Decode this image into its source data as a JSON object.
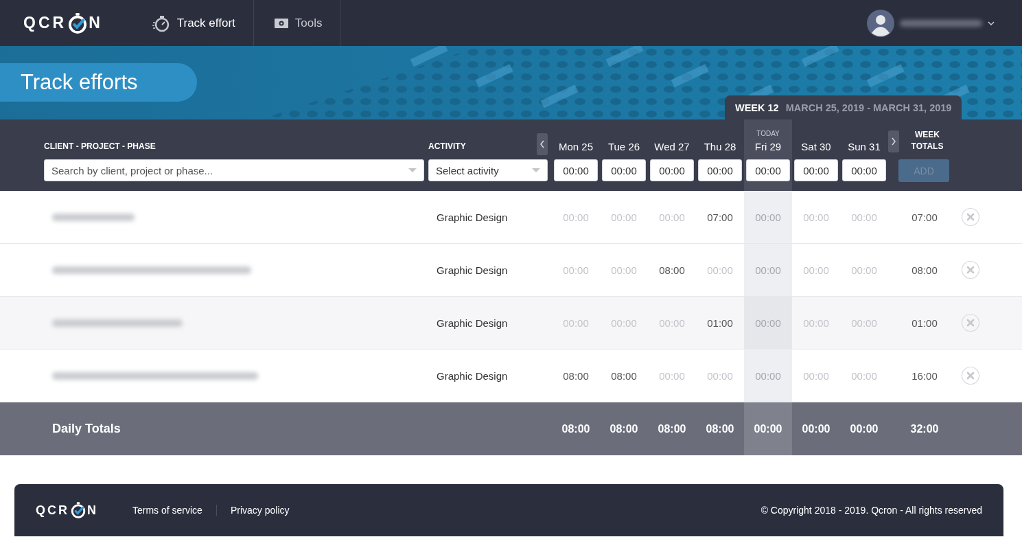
{
  "nav": {
    "logo": {
      "left": "QCR",
      "right": "N"
    },
    "items": [
      {
        "label": "Track effort",
        "selected": true
      },
      {
        "label": "Tools",
        "selected": false
      }
    ]
  },
  "banner": {
    "title": "Track efforts",
    "week": {
      "number": "WEEK 12",
      "range": "MARCH 25, 2019 - MARCH 31, 2019"
    }
  },
  "entry": {
    "project_label": "CLIENT - PROJECT - PHASE",
    "project_search": {
      "placeholder": "Search by client, project or phase..."
    },
    "activity_label": "ACTIVITY",
    "activity_select": {
      "value": "Select activity"
    },
    "days": [
      {
        "label": "Mon 25",
        "today": false,
        "input": "00:00"
      },
      {
        "label": "Tue 26",
        "today": false,
        "input": "00:00"
      },
      {
        "label": "Wed 27",
        "today": false,
        "input": "00:00"
      },
      {
        "label": "Thu 28",
        "today": false,
        "input": "00:00"
      },
      {
        "label": "Fri 29",
        "today": true,
        "note": "TODAY",
        "input": "00:00"
      },
      {
        "label": "Sat 30",
        "today": false,
        "input": "00:00"
      },
      {
        "label": "Sun 31",
        "today": false,
        "input": "00:00"
      }
    ],
    "totals_label": "WEEK TOTALS",
    "add_button": {
      "label": "ADD",
      "disabled": true
    }
  },
  "rows": [
    {
      "activity": "Graphic Design",
      "highlighted": false,
      "cells": [
        {
          "value": "00:00",
          "filled": false
        },
        {
          "value": "00:00",
          "filled": false
        },
        {
          "value": "00:00",
          "filled": false
        },
        {
          "value": "07:00",
          "filled": true
        },
        {
          "value": "00:00",
          "filled": false
        },
        {
          "value": "00:00",
          "filled": false
        },
        {
          "value": "00:00",
          "filled": false
        }
      ],
      "total": "07:00"
    },
    {
      "activity": "Graphic Design",
      "highlighted": false,
      "cells": [
        {
          "value": "00:00",
          "filled": false
        },
        {
          "value": "00:00",
          "filled": false
        },
        {
          "value": "08:00",
          "filled": true
        },
        {
          "value": "00:00",
          "filled": false
        },
        {
          "value": "00:00",
          "filled": false
        },
        {
          "value": "00:00",
          "filled": false
        },
        {
          "value": "00:00",
          "filled": false
        }
      ],
      "total": "08:00"
    },
    {
      "activity": "Graphic Design",
      "highlighted": true,
      "cells": [
        {
          "value": "00:00",
          "filled": false
        },
        {
          "value": "00:00",
          "filled": false
        },
        {
          "value": "00:00",
          "filled": false
        },
        {
          "value": "01:00",
          "filled": true
        },
        {
          "value": "00:00",
          "filled": false
        },
        {
          "value": "00:00",
          "filled": false
        },
        {
          "value": "00:00",
          "filled": false
        }
      ],
      "total": "01:00"
    },
    {
      "activity": "Graphic Design",
      "highlighted": false,
      "cells": [
        {
          "value": "08:00",
          "filled": true
        },
        {
          "value": "08:00",
          "filled": true
        },
        {
          "value": "00:00",
          "filled": false
        },
        {
          "value": "00:00",
          "filled": false
        },
        {
          "value": "00:00",
          "filled": false
        },
        {
          "value": "00:00",
          "filled": false
        },
        {
          "value": "00:00",
          "filled": false
        }
      ],
      "total": "16:00"
    }
  ],
  "daily_totals": {
    "label": "Daily Totals",
    "cells": [
      "08:00",
      "08:00",
      "08:00",
      "08:00",
      "00:00",
      "00:00",
      "00:00"
    ],
    "total": "32:00"
  },
  "footer": {
    "logo": {
      "left": "QCR",
      "right": "N"
    },
    "links": [
      "Terms of service",
      "Privacy policy"
    ],
    "copyright": "© Copyright 2018 - 2019. Qcron - All rights reserved"
  }
}
